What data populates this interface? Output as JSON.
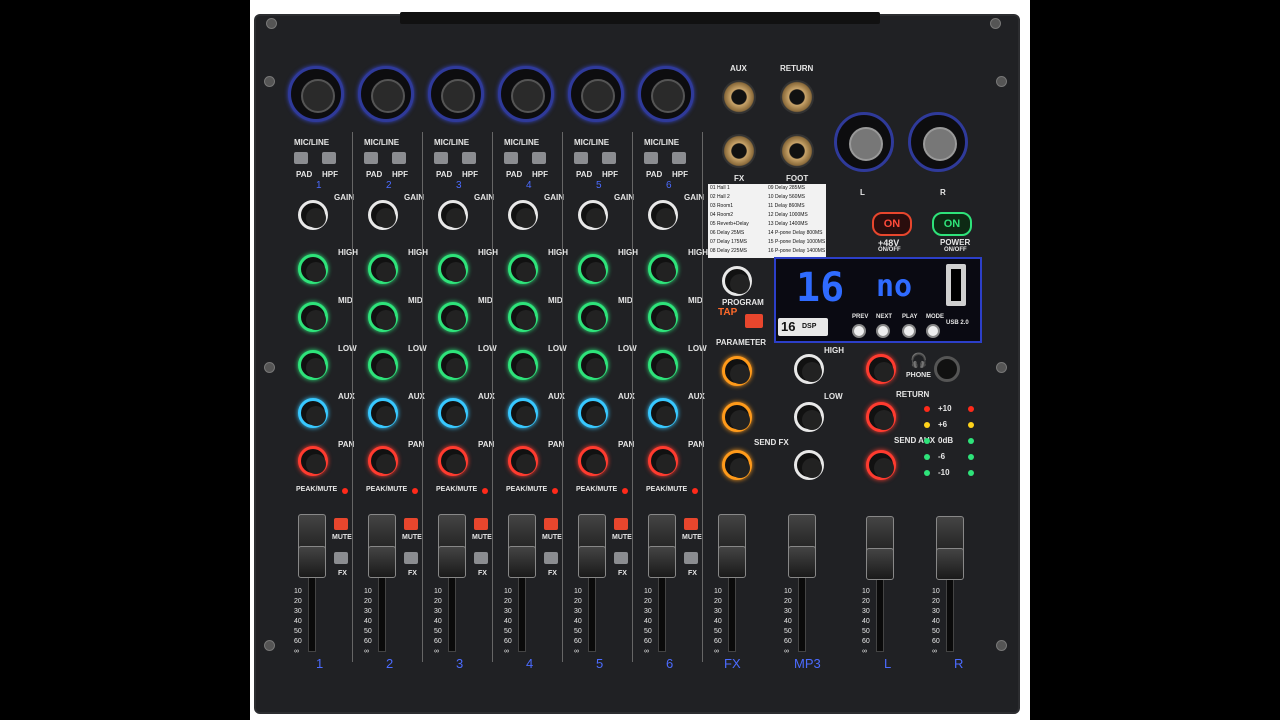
{
  "channels": {
    "mic_line_label": "MIC/LINE",
    "pad_label": "PAD",
    "hpf_label": "HPF",
    "gain_label": "GAIN",
    "high_label": "HIGH",
    "mid_label": "MID",
    "low_label": "LOW",
    "aux_label": "AUX",
    "pan_label": "PAN",
    "peak_mute_label": "PEAK/MUTE",
    "mute_label": "MUTE",
    "fx_label": "FX",
    "numbers": [
      "1",
      "2",
      "3",
      "4",
      "5",
      "6"
    ]
  },
  "fx_section": {
    "aux_label": "AUX",
    "return_label": "RETURN",
    "fx_label": "FX",
    "foot_label": "FOOT",
    "program_label": "PROGRAM",
    "tap_label": "TAP",
    "parameter_label": "PARAMETER",
    "send_fx_label": "SEND FX",
    "presets": [
      "01 Hall 1",
      "02 Hall 2",
      "03 Room1",
      "04 Room2",
      "05 Reverb+Delay",
      "06 Delay 25MS",
      "07 Delay 175MS",
      "08 Delay 225MS",
      "09 Delay 285MS",
      "10 Delay 560MS",
      "11 Delay 860MS",
      "12 Delay 1000MS",
      "13 Delay 1400MS",
      "14 P-pone Delay 800MS",
      "15 P-pone Delay 1000MS",
      "16 P-pone Delay 1400MS"
    ]
  },
  "display": {
    "left_digits": "16",
    "right_text": "no",
    "badge": "16",
    "badge_sub": "DSP",
    "prev": "PREV",
    "next": "NEXT",
    "play": "PLAY",
    "mode": "MODE",
    "usb": "USB 2.0"
  },
  "power": {
    "phantom_on": "ON",
    "power_on": "ON",
    "phantom_label": "+48V",
    "phantom_sub": "ON/OFF",
    "power_label": "POWER",
    "power_sub": "ON/OFF",
    "out_l": "L",
    "out_r": "R"
  },
  "master": {
    "phone_label": "PHONE",
    "return_label": "RETURN",
    "send_aux_label": "SEND AUX",
    "meter": [
      "+10",
      "+6",
      "0dB",
      "-6",
      "-10"
    ],
    "high_label": "HIGH",
    "low_label": "LOW"
  },
  "faders": [
    "1",
    "2",
    "3",
    "4",
    "5",
    "6",
    "FX",
    "MP3",
    "L",
    "R"
  ],
  "fader_scale": [
    "10",
    "20",
    "30",
    "40",
    "50",
    "60",
    "∞"
  ],
  "colors": {
    "green": "#2ee37a",
    "cyan": "#38c8ff",
    "red": "#ff3b2f",
    "orange": "#ff9a1a",
    "blue": "#2f6bff",
    "panel": "#202124"
  }
}
